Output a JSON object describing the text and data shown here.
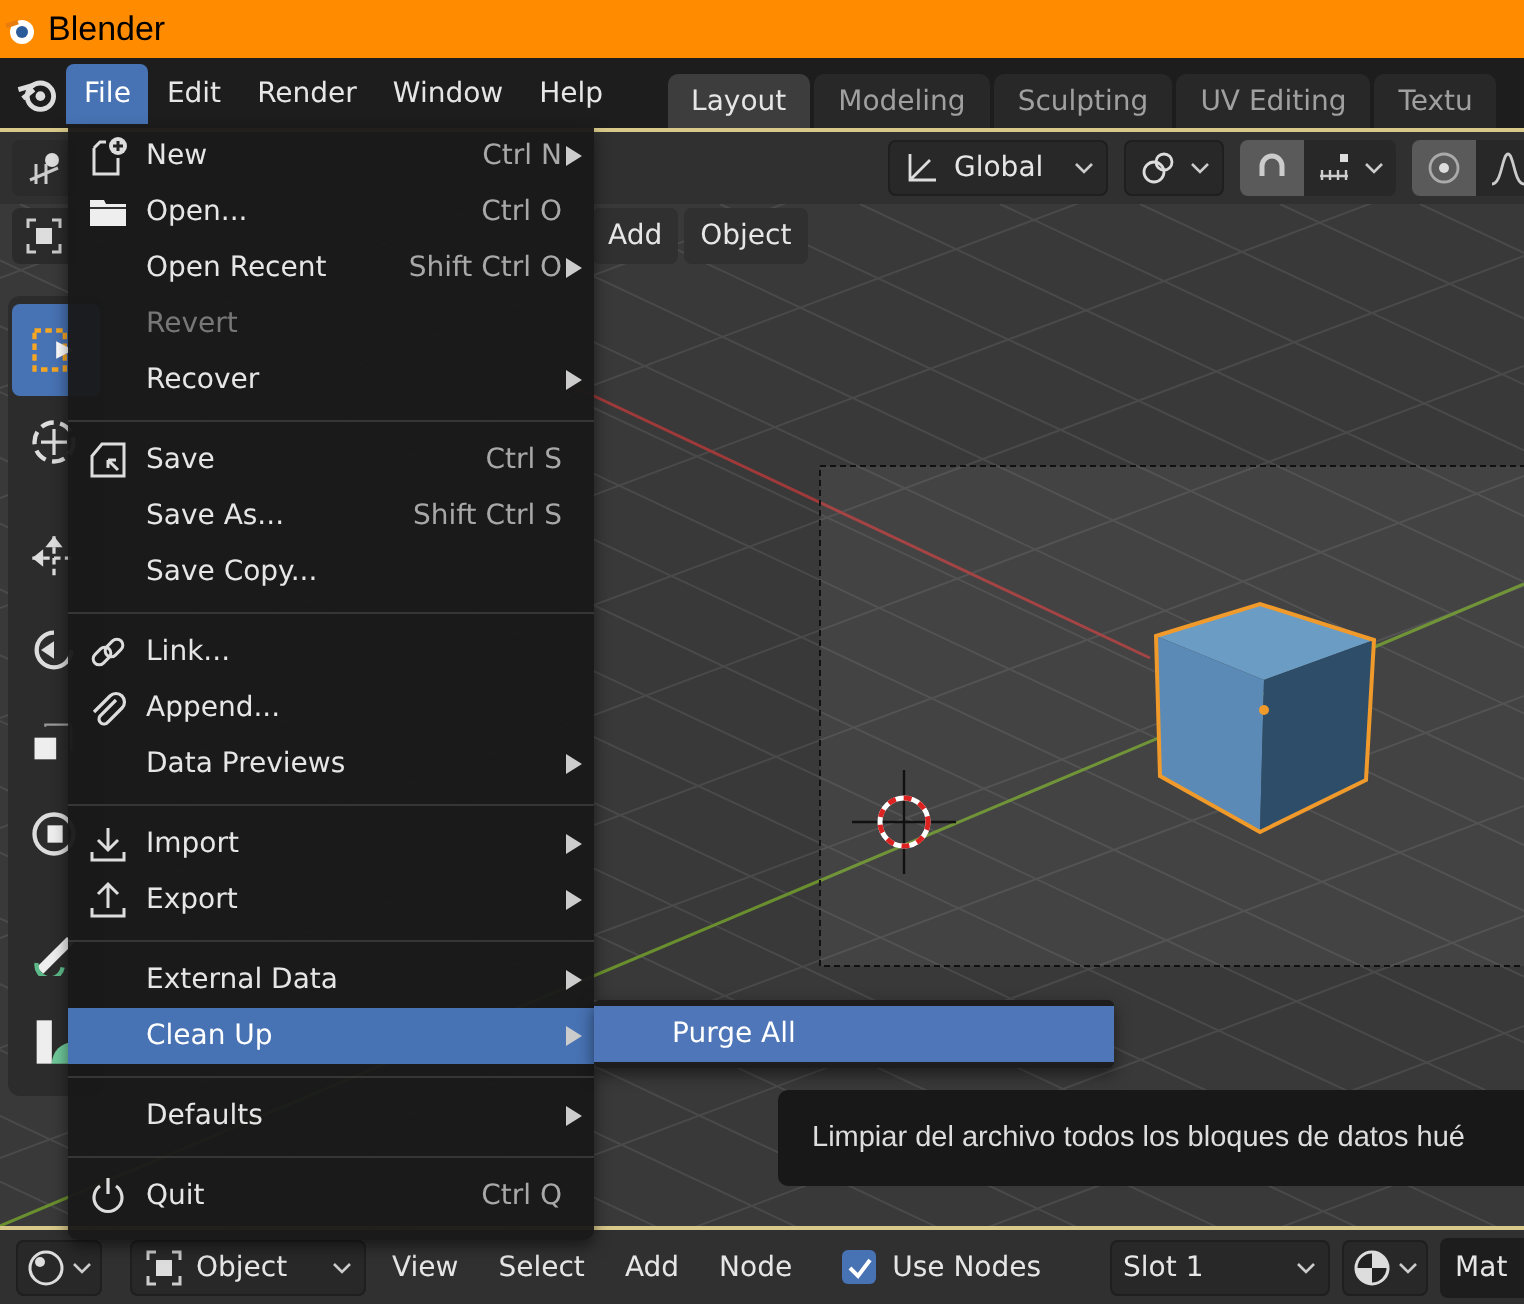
{
  "window": {
    "title": "Blender"
  },
  "menubar": [
    {
      "label": "File",
      "selected": true
    },
    {
      "label": "Edit",
      "selected": false
    },
    {
      "label": "Render",
      "selected": false
    },
    {
      "label": "Window",
      "selected": false
    },
    {
      "label": "Help",
      "selected": false
    }
  ],
  "workspace_tabs": [
    {
      "label": "Layout",
      "selected": true
    },
    {
      "label": "Modeling",
      "selected": false
    },
    {
      "label": "Sculpting",
      "selected": false
    },
    {
      "label": "UV Editing",
      "selected": false
    },
    {
      "label": "Textu",
      "selected": false
    }
  ],
  "viewport_header": {
    "orientation": "Global",
    "snap_on": true,
    "proportional_on": true
  },
  "viewport_menus": [
    "Add",
    "Object"
  ],
  "file_menu": {
    "groups": [
      [
        {
          "label": "New",
          "shortcut": "Ctrl N",
          "kind": "new",
          "submenu": true,
          "disabled": false,
          "selected": false
        },
        {
          "label": "Open...",
          "shortcut": "Ctrl O",
          "kind": "open",
          "submenu": false,
          "disabled": false,
          "selected": false
        },
        {
          "label": "Open Recent",
          "shortcut": "Shift Ctrl O",
          "submenu": true,
          "disabled": false,
          "selected": false
        },
        {
          "label": "Revert",
          "submenu": false,
          "disabled": true,
          "selected": false
        },
        {
          "label": "Recover",
          "submenu": true,
          "disabled": false,
          "selected": false
        }
      ],
      [
        {
          "label": "Save",
          "shortcut": "Ctrl S",
          "kind": "save",
          "submenu": false,
          "disabled": false,
          "selected": false
        },
        {
          "label": "Save As...",
          "shortcut": "Shift Ctrl S",
          "submenu": false,
          "disabled": false,
          "selected": false
        },
        {
          "label": "Save Copy...",
          "submenu": false,
          "disabled": false,
          "selected": false
        }
      ],
      [
        {
          "label": "Link...",
          "kind": "link",
          "submenu": false,
          "disabled": false,
          "selected": false
        },
        {
          "label": "Append...",
          "kind": "append",
          "submenu": false,
          "disabled": false,
          "selected": false
        },
        {
          "label": "Data Previews",
          "submenu": true,
          "disabled": false,
          "selected": false
        }
      ],
      [
        {
          "label": "Import",
          "kind": "import",
          "submenu": true,
          "disabled": false,
          "selected": false
        },
        {
          "label": "Export",
          "kind": "export",
          "submenu": true,
          "disabled": false,
          "selected": false
        }
      ],
      [
        {
          "label": "External Data",
          "submenu": true,
          "disabled": false,
          "selected": false
        },
        {
          "label": "Clean Up",
          "submenu": true,
          "disabled": false,
          "selected": true
        }
      ],
      [
        {
          "label": "Defaults",
          "submenu": true,
          "disabled": false,
          "selected": false
        }
      ],
      [
        {
          "label": "Quit",
          "shortcut": "Ctrl Q",
          "kind": "quit",
          "submenu": false,
          "disabled": false,
          "selected": false
        }
      ]
    ]
  },
  "submenu": [
    {
      "label": "Purge All",
      "selected": true
    }
  ],
  "tooltip": "Limpiar del archivo todos los bloques de datos hué",
  "node_header": {
    "editor": "Object",
    "menus": [
      "View",
      "Select",
      "Add",
      "Node"
    ],
    "use_nodes": {
      "label": "Use Nodes",
      "checked": true
    },
    "slot": "Slot 1",
    "material": "Mat"
  }
}
